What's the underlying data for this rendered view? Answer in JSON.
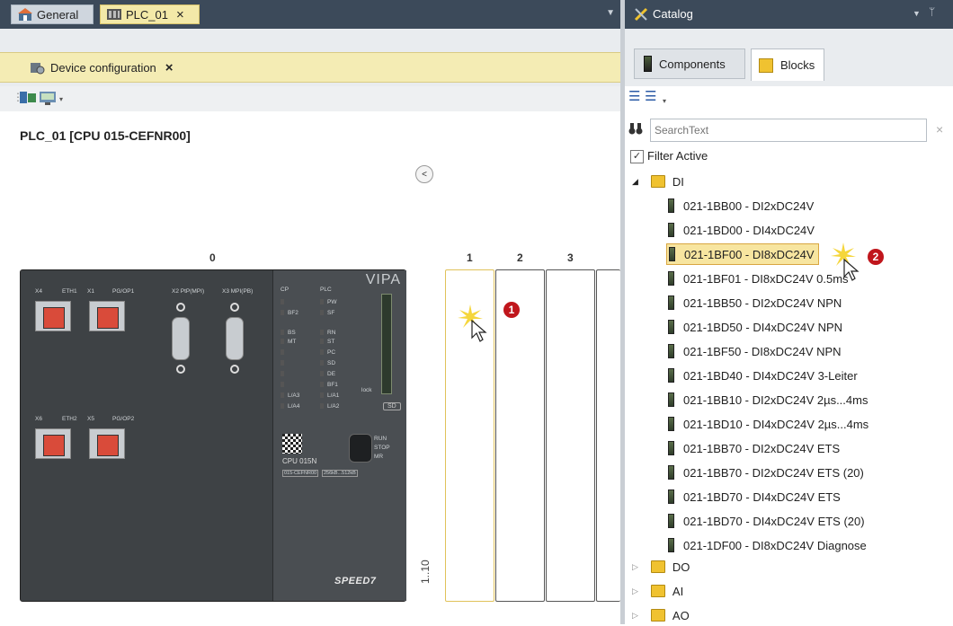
{
  "left": {
    "tabs": [
      {
        "label": "General"
      },
      {
        "label": "PLC_01",
        "close": "×"
      }
    ],
    "editor_tab": {
      "label": "Device configuration",
      "close": "×"
    },
    "device_title": "PLC_01 [CPU 015-CEFNR00]",
    "rack": {
      "numbers": [
        "0",
        "1",
        "2",
        "3"
      ],
      "slot_range": "1..10"
    },
    "cpu": {
      "brand": "VIPA",
      "name": "CPU 015N",
      "order_no": "015-CEFNR00",
      "mem": "256kB...512kB",
      "port_labels": [
        "X4",
        "ETH1",
        "X1",
        "PG/OP1",
        "X2 PtP(MPI)",
        "X3 MPI(PB)",
        "X6",
        "ETH2",
        "X5",
        "PG/OP2"
      ],
      "led_labels_left": [
        "CP",
        "BF2",
        "BS",
        "MT",
        "L/A3",
        "L/A4"
      ],
      "led_labels_right": [
        "PLC",
        "PW",
        "SF",
        "RN",
        "ST",
        "PC",
        "SD",
        "DE",
        "BF1",
        "L/A1",
        "L/A2"
      ],
      "switch_labels": [
        "RUN",
        "STOP",
        "MR"
      ],
      "sd_label": "SD",
      "lock_label": "lock",
      "speed_logo": "SPEED7"
    },
    "callout1": "1"
  },
  "catalog": {
    "title": "Catalog",
    "tabs": [
      {
        "label": "Components"
      },
      {
        "label": "Blocks"
      }
    ],
    "search_placeholder": "SearchText",
    "filter_label": "Filter Active",
    "folders": [
      {
        "label": "DI",
        "expanded": true
      },
      {
        "label": "DO",
        "expanded": false
      },
      {
        "label": "AI",
        "expanded": false
      },
      {
        "label": "AO",
        "expanded": false
      }
    ],
    "di_items": [
      "021-1BB00 - DI2xDC24V",
      "021-1BD00 - DI4xDC24V",
      "021-1BF00 - DI8xDC24V",
      "021-1BF01 - DI8xDC24V 0.5ms",
      "021-1BB50 - DI2xDC24V NPN",
      "021-1BD50 - DI4xDC24V NPN",
      "021-1BF50 - DI8xDC24V NPN",
      "021-1BD40 - DI4xDC24V 3-Leiter",
      "021-1BB10 - DI2xDC24V 2µs...4ms",
      "021-1BD10 - DI4xDC24V 2µs...4ms",
      "021-1BB70 - DI2xDC24V ETS",
      "021-1BB70 - DI2xDC24V ETS (20)",
      "021-1BD70 - DI4xDC24V ETS",
      "021-1BD70 - DI4xDC24V ETS (20)",
      "021-1DF00 - DI8xDC24V Diagnose"
    ],
    "selected_index": 2,
    "callout2": "2"
  }
}
